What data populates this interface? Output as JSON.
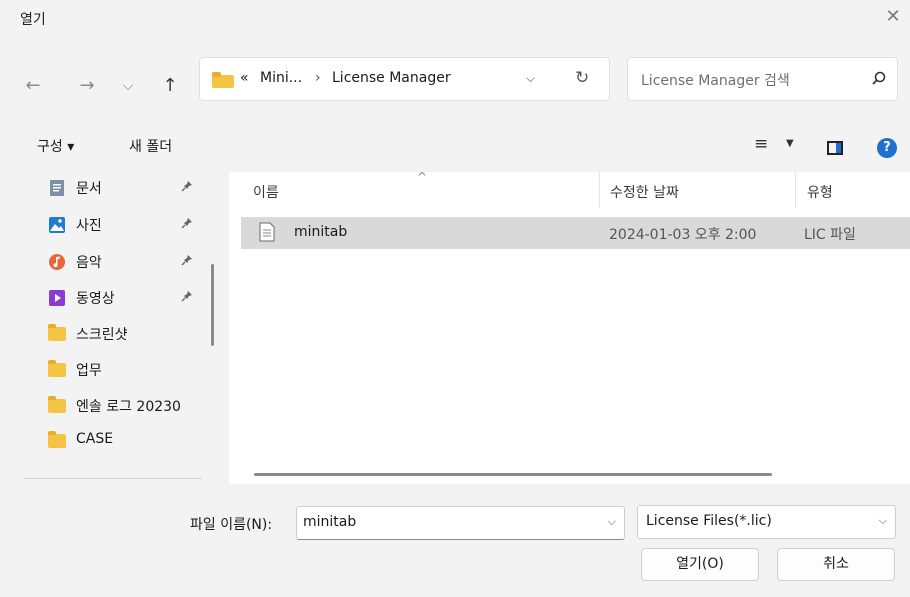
{
  "window": {
    "title": "열기",
    "close_glyph": "✕"
  },
  "nav": {
    "back_glyph": "←",
    "forward_glyph": "→",
    "recent_glyph": "⌵",
    "up_glyph": "↑",
    "address": {
      "overflow": "«",
      "crumbs": [
        "Mini...",
        "License Manager"
      ],
      "separator": "›",
      "dropdown_glyph": "⌵",
      "refresh_glyph": "↻"
    },
    "search_placeholder": "License Manager 검색"
  },
  "toolbar": {
    "organize_label": "구성 ▾",
    "new_folder_label": "새 폴더",
    "view_glyph": "≡",
    "view_dropdown_glyph": "▼",
    "help_glyph": "?"
  },
  "sidebar": {
    "items": [
      {
        "label": "문서",
        "icon": "documents-icon",
        "pinned": true
      },
      {
        "label": "사진",
        "icon": "pictures-icon",
        "pinned": true
      },
      {
        "label": "음악",
        "icon": "music-icon",
        "pinned": true
      },
      {
        "label": "동영상",
        "icon": "videos-icon",
        "pinned": true
      },
      {
        "label": "스크린샷",
        "icon": "folder-icon",
        "pinned": false
      },
      {
        "label": "업무",
        "icon": "folder-icon",
        "pinned": false
      },
      {
        "label": "엔솔 로그 20230",
        "icon": "folder-icon",
        "pinned": false
      },
      {
        "label": "CASE",
        "icon": "folder-icon",
        "pinned": false
      }
    ],
    "pin_glyph": "📌"
  },
  "list": {
    "columns": [
      "이름",
      "수정한 날짜",
      "유형"
    ],
    "sort_glyph": "^",
    "rows": [
      {
        "name": "minitab",
        "modified": "2024-01-03 오후 2:00",
        "type": "LIC 파일"
      }
    ]
  },
  "footer": {
    "filename_label": "파일 이름(N):",
    "filename_value": "minitab",
    "filetype_value": "License Files(*.lic)",
    "dropdown_glyph": "⌵",
    "open_label": "열기(O)",
    "cancel_label": "취소"
  },
  "colors": {
    "accent": "#1f6fd1",
    "folder": "#f6c445",
    "selection": "#d9d9d9",
    "chrome": "#f3f3f3"
  }
}
